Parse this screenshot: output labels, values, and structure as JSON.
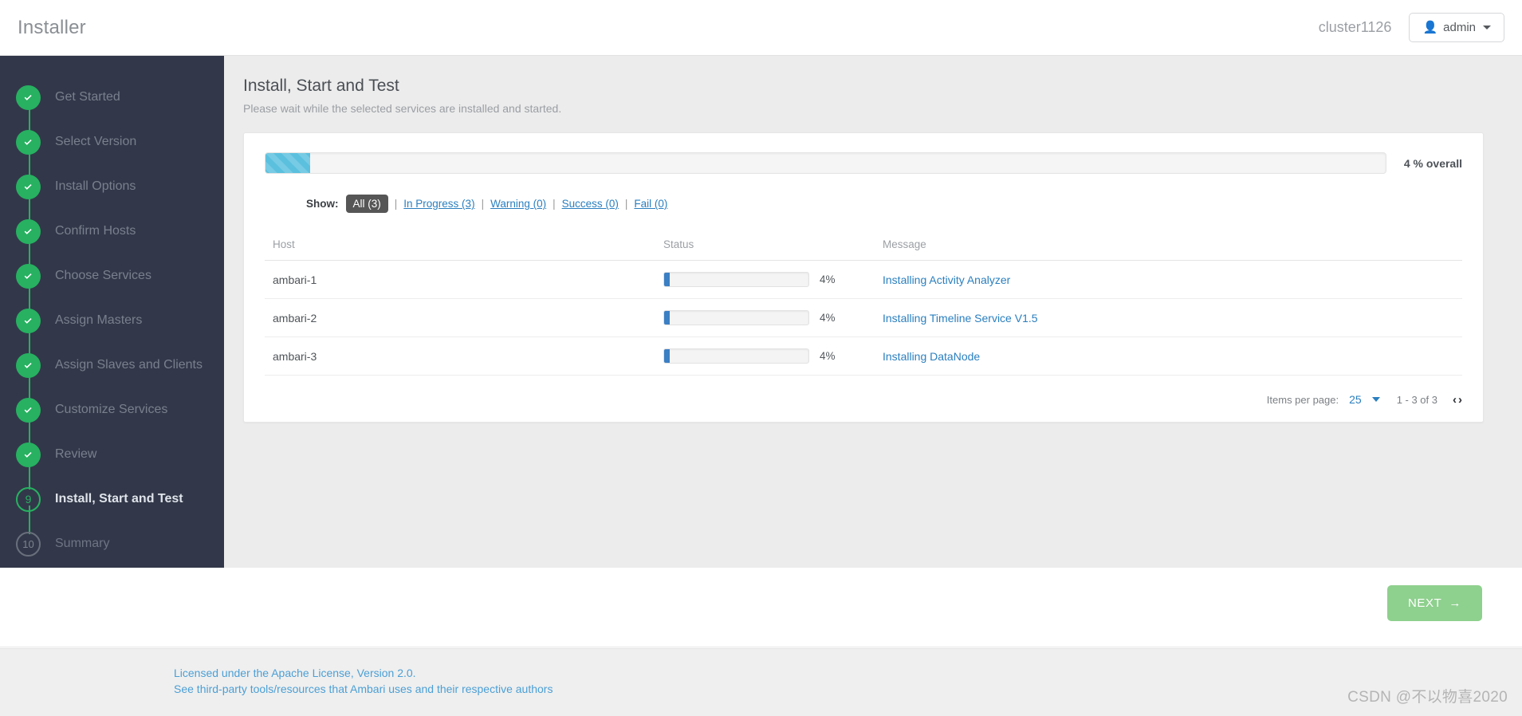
{
  "header": {
    "brand_title": "Installer",
    "cluster_name": "cluster1126",
    "user_label": "admin",
    "user_icon": "user-icon",
    "caret_icon": "caret-down-icon"
  },
  "sidebar": {
    "steps": [
      {
        "number": "1",
        "label": "Get Started",
        "state": "done"
      },
      {
        "number": "2",
        "label": "Select Version",
        "state": "done"
      },
      {
        "number": "3",
        "label": "Install Options",
        "state": "done"
      },
      {
        "number": "4",
        "label": "Confirm Hosts",
        "state": "done"
      },
      {
        "number": "5",
        "label": "Choose Services",
        "state": "done"
      },
      {
        "number": "6",
        "label": "Assign Masters",
        "state": "done"
      },
      {
        "number": "7",
        "label": "Assign Slaves and Clients",
        "state": "done"
      },
      {
        "number": "8",
        "label": "Customize Services",
        "state": "done"
      },
      {
        "number": "9",
        "label": "Review",
        "state": "done"
      },
      {
        "number": "9",
        "label": "Install, Start and Test",
        "state": "current"
      },
      {
        "number": "10",
        "label": "Summary",
        "state": "pending"
      }
    ]
  },
  "main": {
    "title": "Install, Start and Test",
    "subtitle": "Please wait while the selected services are installed and started.",
    "overall": {
      "percent": 4,
      "percent_label": "4 % overall"
    },
    "filter": {
      "show_label": "Show:",
      "options": [
        {
          "label": "All (3)",
          "active": true
        },
        {
          "label": "In Progress (3)",
          "active": false
        },
        {
          "label": "Warning (0)",
          "active": false
        },
        {
          "label": "Success (0)",
          "active": false
        },
        {
          "label": "Fail (0)",
          "active": false
        }
      ],
      "separator": "|"
    },
    "table": {
      "columns": [
        "Host",
        "Status",
        "Message"
      ],
      "rows": [
        {
          "host": "ambari-1",
          "percent": 4,
          "percent_label": "4%",
          "message": "Installing Activity Analyzer"
        },
        {
          "host": "ambari-2",
          "percent": 4,
          "percent_label": "4%",
          "message": "Installing Timeline Service V1.5"
        },
        {
          "host": "ambari-3",
          "percent": 4,
          "percent_label": "4%",
          "message": "Installing DataNode"
        }
      ]
    },
    "pager": {
      "items_per_page_label": "Items per page:",
      "items_per_page_value": "25",
      "range_label": "1 - 3 of 3",
      "prev_icon": "chevron-left-icon",
      "next_icon": "chevron-right-icon",
      "prev_glyph": "‹",
      "next_glyph": "›"
    }
  },
  "actions": {
    "next_label": "NEXT",
    "next_arrow": "→"
  },
  "footer": {
    "license_link": "Licensed under the Apache License, Version 2.0.",
    "third_party_link": "See third-party tools/resources that Ambari uses and their respective authors",
    "watermark": "CSDN @不以物喜2020"
  },
  "colors": {
    "sidebar_bg": "#323849",
    "step_done": "#27b161",
    "overall_bar": "#5bc0de",
    "row_bar": "#3b7fc4",
    "link": "#2a7fbf",
    "next_button": "#8ed08e"
  }
}
